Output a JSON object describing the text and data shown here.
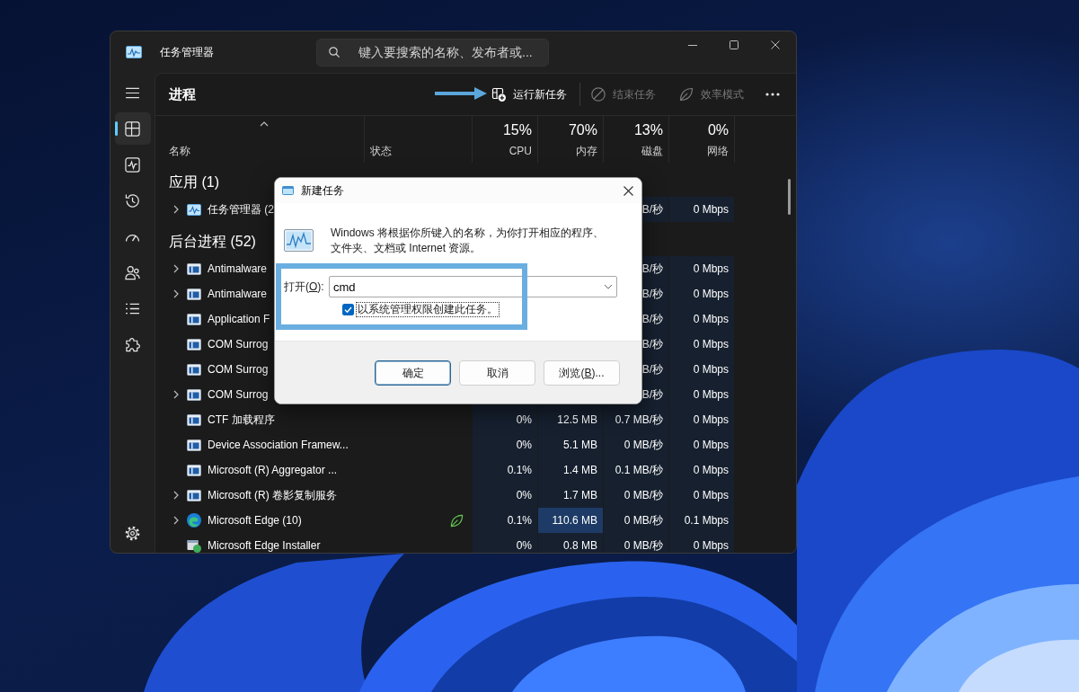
{
  "window": {
    "title": "任务管理器"
  },
  "search": {
    "placeholder": "键入要搜索的名称、发布者或..."
  },
  "nav": [
    {
      "kind": "processes",
      "selected": true
    },
    {
      "kind": "performance",
      "selected": false
    },
    {
      "kind": "history",
      "selected": false
    },
    {
      "kind": "startup",
      "selected": false
    },
    {
      "kind": "users",
      "selected": false
    },
    {
      "kind": "details",
      "selected": false
    },
    {
      "kind": "services",
      "selected": false
    }
  ],
  "page": {
    "title": "进程"
  },
  "toolbar": [
    {
      "kind": "run",
      "label": "运行新任务",
      "disabled": false
    },
    {
      "kind": "end",
      "label": "结束任务",
      "disabled": true
    },
    {
      "kind": "efficiency",
      "label": "效率模式",
      "disabled": true
    }
  ],
  "columns": [
    {
      "label": "名称",
      "sorted": true
    },
    {
      "label": "状态",
      "sorted": false
    },
    {
      "usage": "15%",
      "label": "CPU",
      "sorted": false
    },
    {
      "usage": "70%",
      "label": "内存",
      "sorted": false
    },
    {
      "usage": "13%",
      "label": "磁盘",
      "sorted": false
    },
    {
      "usage": "0%",
      "label": "网络",
      "sorted": false
    }
  ],
  "groups": [
    {
      "title": "应用 (1)",
      "rows": [
        {
          "kind": "taskmgr",
          "name": "任务管理器 (2",
          "expandable": true,
          "disk": "B/秒",
          "network": "0 Mbps"
        }
      ]
    },
    {
      "title": "后台进程 (52)",
      "rows": [
        {
          "kind": "process",
          "name": "Antimalware",
          "expandable": true,
          "disk": "B/秒",
          "network": "0 Mbps"
        },
        {
          "kind": "process",
          "name": "Antimalware",
          "expandable": true,
          "disk": "B/秒",
          "network": "0 Mbps"
        },
        {
          "kind": "process",
          "name": "Application F",
          "expandable": false,
          "disk": "B/秒",
          "network": "0 Mbps"
        },
        {
          "kind": "process",
          "name": "COM Surrog",
          "expandable": false,
          "disk": "B/秒",
          "network": "0 Mbps"
        },
        {
          "kind": "process",
          "name": "COM Surrog",
          "expandable": false,
          "disk": "B/秒",
          "network": "0 Mbps"
        },
        {
          "kind": "process",
          "name": "COM Surrog",
          "expandable": true,
          "disk": "B/秒",
          "network": "0 Mbps"
        },
        {
          "kind": "process",
          "name": "CTF 加载程序",
          "expandable": false,
          "efficiency_mode": false,
          "cpu": "0%",
          "memory": "12.5 MB",
          "memory_highlight": false,
          "disk": "0.7 MB/秒",
          "network": "0 Mbps"
        },
        {
          "kind": "process",
          "name": "Device Association Framew...",
          "expandable": false,
          "efficiency_mode": false,
          "cpu": "0%",
          "memory": "5.1 MB",
          "memory_highlight": false,
          "disk": "0 MB/秒",
          "network": "0 Mbps"
        },
        {
          "kind": "process",
          "name": "Microsoft (R) Aggregator ...",
          "expandable": false,
          "efficiency_mode": false,
          "cpu": "0.1%",
          "memory": "1.4 MB",
          "memory_highlight": false,
          "disk": "0.1 MB/秒",
          "network": "0 Mbps"
        },
        {
          "kind": "process",
          "name": "Microsoft (R) 卷影复制服务",
          "expandable": true,
          "efficiency_mode": false,
          "cpu": "0%",
          "memory": "1.7 MB",
          "memory_highlight": false,
          "disk": "0 MB/秒",
          "network": "0 Mbps"
        },
        {
          "kind": "browser",
          "name": "Microsoft Edge (10)",
          "expandable": true,
          "efficiency_mode": true,
          "cpu": "0.1%",
          "memory": "110.6 MB",
          "memory_highlight": true,
          "disk": "0 MB/秒",
          "network": "0.1 Mbps"
        },
        {
          "kind": "installer",
          "name": "Microsoft Edge Installer",
          "expandable": false,
          "efficiency_mode": false,
          "cpu": "0%",
          "memory": "0.8 MB",
          "memory_highlight": false,
          "disk": "0 MB/秒",
          "network": "0 Mbps"
        }
      ]
    }
  ],
  "dialog": {
    "title": "新建任务",
    "message": "Windows 将根据你所键入的名称，为你打开相应的程序、文件夹、文档或 Internet 资源。",
    "open": {
      "label": "打开(",
      "access_key": "O",
      "label_after": "):",
      "value": "cmd"
    },
    "checkbox": {
      "label": "以系统管理权限创建此任务。",
      "checked": true,
      "focused": true
    },
    "buttons": [
      {
        "label": "确定",
        "default": true
      },
      {
        "label": "取消",
        "default": false
      },
      {
        "label": "浏览(",
        "access_key": "B",
        "label_after": ")...",
        "default": false
      }
    ]
  }
}
